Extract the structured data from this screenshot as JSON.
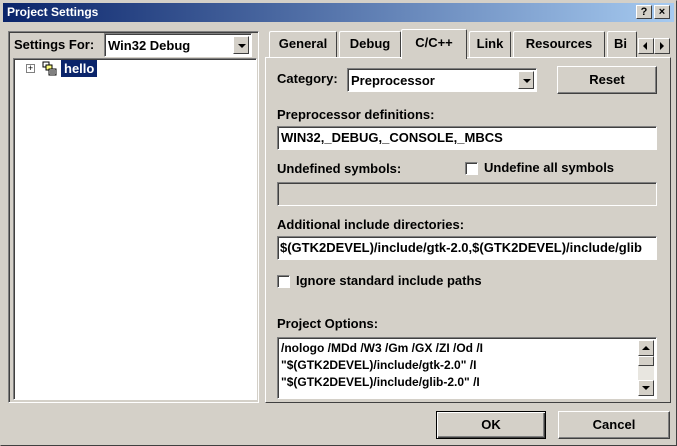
{
  "window": {
    "title": "Project Settings"
  },
  "caption_buttons": {
    "help": "?",
    "close": "×"
  },
  "settings_for": {
    "label": "Settings For:",
    "value": "Win32 Debug"
  },
  "tree": {
    "expander": "+",
    "project": "hello"
  },
  "tabs": [
    {
      "label": "General"
    },
    {
      "label": "Debug"
    },
    {
      "label": "C/C++"
    },
    {
      "label": "Link"
    },
    {
      "label": "Resources"
    },
    {
      "label": "Bi"
    }
  ],
  "category": {
    "label": "Category:",
    "value": "Preprocessor"
  },
  "reset_label": "Reset",
  "preprocessor_definitions": {
    "label": "Preprocessor definitions:",
    "value": "WIN32,_DEBUG,_CONSOLE,_MBCS"
  },
  "undefined_symbols": {
    "label": "Undefined symbols:",
    "value": ""
  },
  "undefine_all": {
    "label": "Undefine all symbols",
    "checked": false
  },
  "additional_include": {
    "label": "Additional include directories:",
    "value": "$(GTK2DEVEL)/include/gtk-2.0,$(GTK2DEVEL)/include/glib"
  },
  "ignore_standard": {
    "label": "Ignore standard include paths",
    "checked": false
  },
  "project_options": {
    "label": "Project Options:",
    "lines": [
      "/nologo /MDd /W3 /Gm /GX /ZI /Od /I",
      "\"$(GTK2DEVEL)/include/gtk-2.0\" /I",
      "\"$(GTK2DEVEL)/include/glib-2.0\" /I"
    ]
  },
  "buttons": {
    "ok": "OK",
    "cancel": "Cancel"
  },
  "colors": {
    "face": "#d4d0c8",
    "title_start": "#0a246a",
    "title_end": "#a6caf0",
    "selection": "#0a246a"
  },
  "icons": [
    "expander-plus-icon",
    "project-icon",
    "tab-scroll-left-icon",
    "tab-scroll-right-icon",
    "combo-arrow-icon"
  ]
}
